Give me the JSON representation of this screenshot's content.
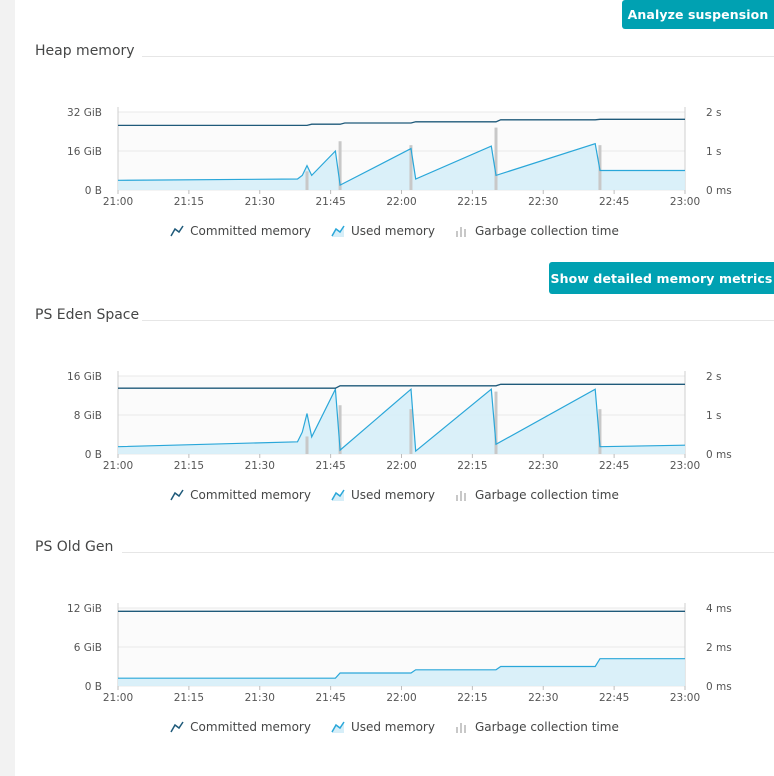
{
  "buttons": {
    "analyze_suspension": "Analyze suspension",
    "show_detailed_metrics": "Show detailed memory metrics"
  },
  "legend": {
    "committed": "Committed memory",
    "used": "Used memory",
    "gc": "Garbage collection time"
  },
  "colors": {
    "accent": "#00a1b2",
    "committed_line": "#1f5a7a",
    "used_line": "#2aa7d9",
    "used_fill": "#d6eef8",
    "gc_bar": "#c8c8c8"
  },
  "chart_data": [
    {
      "type": "line",
      "title": "Heap memory",
      "x_ticks": [
        "21:00",
        "21:15",
        "21:30",
        "21:45",
        "22:00",
        "22:15",
        "22:30",
        "22:45",
        "23:00"
      ],
      "xlim_minutes": [
        0,
        120
      ],
      "y_left_ticks": [
        "0 B",
        "16 GiB",
        "32 GiB"
      ],
      "ylim_left": [
        0,
        32
      ],
      "y_right_ticks": [
        "0 ms",
        "1 s",
        "2 s"
      ],
      "ylim_right": [
        0,
        2
      ],
      "series": [
        {
          "name": "Committed memory",
          "kind": "line",
          "x": [
            0,
            40,
            41,
            47,
            48,
            62,
            63,
            80,
            81,
            101,
            102,
            120
          ],
          "values": [
            26.5,
            26.5,
            27,
            27,
            27.5,
            27.5,
            28,
            28,
            28.8,
            28.8,
            29,
            29
          ]
        },
        {
          "name": "Used memory",
          "kind": "area",
          "x": [
            0,
            38,
            39,
            40,
            41,
            46,
            47,
            62,
            63,
            79,
            80,
            101,
            102,
            120
          ],
          "values": [
            4,
            4.5,
            6,
            10,
            6,
            16,
            2,
            17,
            4.5,
            18,
            6,
            19,
            8,
            8
          ]
        },
        {
          "name": "Garbage collection time",
          "kind": "bar",
          "x": [
            40,
            47,
            62,
            80,
            102
          ],
          "values": [
            0.48,
            1.25,
            1.15,
            1.6,
            1.15
          ]
        }
      ]
    },
    {
      "type": "line",
      "title": "PS Eden Space",
      "x_ticks": [
        "21:00",
        "21:15",
        "21:30",
        "21:45",
        "22:00",
        "22:15",
        "22:30",
        "22:45",
        "23:00"
      ],
      "xlim_minutes": [
        0,
        120
      ],
      "y_left_ticks": [
        "0 B",
        "8 GiB",
        "16 GiB"
      ],
      "ylim_left": [
        0,
        16
      ],
      "y_right_ticks": [
        "0 ms",
        "1 s",
        "2 s"
      ],
      "ylim_right": [
        0,
        2
      ],
      "series": [
        {
          "name": "Committed memory",
          "kind": "line",
          "x": [
            0,
            46,
            47,
            80,
            81,
            120
          ],
          "values": [
            13.5,
            13.5,
            14,
            14,
            14.3,
            14.3
          ]
        },
        {
          "name": "Used memory",
          "kind": "area",
          "x": [
            0,
            38,
            39,
            40,
            41,
            46,
            47,
            62,
            63,
            79,
            80,
            101,
            102,
            120
          ],
          "values": [
            1.5,
            2.5,
            4.5,
            8.3,
            3.5,
            13.3,
            0.8,
            13.3,
            0.6,
            13.3,
            2,
            13.3,
            1.5,
            1.8
          ]
        },
        {
          "name": "Garbage collection time",
          "kind": "bar",
          "x": [
            40,
            47,
            62,
            80,
            102
          ],
          "values": [
            0.45,
            1.25,
            1.15,
            1.6,
            1.15
          ]
        }
      ]
    },
    {
      "type": "line",
      "title": "PS Old Gen",
      "x_ticks": [
        "21:00",
        "21:15",
        "21:30",
        "21:45",
        "22:00",
        "22:15",
        "22:30",
        "22:45",
        "23:00"
      ],
      "xlim_minutes": [
        0,
        120
      ],
      "y_left_ticks": [
        "0 B",
        "6 GiB",
        "12 GiB"
      ],
      "ylim_left": [
        0,
        12
      ],
      "y_right_ticks": [
        "0 ms",
        "2 ms",
        "4 ms"
      ],
      "ylim_right": [
        0,
        4
      ],
      "series": [
        {
          "name": "Committed memory",
          "kind": "line",
          "x": [
            0,
            120
          ],
          "values": [
            11.5,
            11.5
          ]
        },
        {
          "name": "Used memory",
          "kind": "area",
          "x": [
            0,
            46,
            47,
            62,
            63,
            80,
            81,
            101,
            102,
            120
          ],
          "values": [
            1.2,
            1.2,
            2,
            2,
            2.5,
            2.5,
            3,
            3,
            4.2,
            4.2
          ]
        },
        {
          "name": "Garbage collection time",
          "kind": "bar",
          "x": [],
          "values": []
        }
      ]
    }
  ]
}
